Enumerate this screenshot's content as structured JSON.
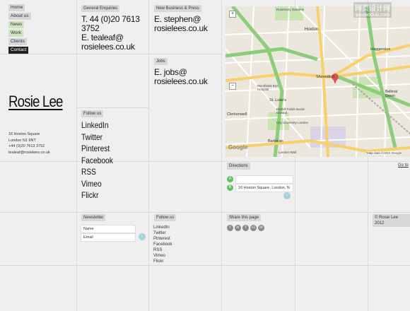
{
  "nav": [
    "Home",
    "About us",
    "News",
    "Work",
    "Clients",
    "Contact"
  ],
  "brand": "Rosie Lee",
  "address": [
    "16 Hoxton Square",
    "London N1 6NT",
    "+44 (0)20 7613 3752",
    "tealeaf@rosielees.co.uk"
  ],
  "general": {
    "label": "General Enquiries",
    "lines": [
      "T. 44 (0)20 7613",
      "3752",
      "E. tealeaf@",
      "rosielees.co.uk"
    ]
  },
  "business": {
    "label": "New Business & Press",
    "lines": [
      "E. stephen@",
      "rosielees.co.uk"
    ]
  },
  "jobs": {
    "label": "Jobs",
    "lines": [
      "E. jobs@",
      "rosielees.co.uk"
    ]
  },
  "follow_big": {
    "label": "Follow us",
    "items": [
      "LinkedIn",
      "Twitter",
      "Pinterest",
      "Facebook",
      "RSS",
      "Vimeo",
      "Flickr"
    ]
  },
  "directions": {
    "label": "Directions",
    "goto": "Go to",
    "from": "A",
    "to": "B",
    "to_value": "16 Hoxton Square, London, N",
    "go_icon": "arrow-right-icon"
  },
  "newsletter": {
    "label": "Newsletter",
    "name_placeholder": "Name",
    "email_placeholder": "Email"
  },
  "follow_small": {
    "label": "Follow us",
    "items": [
      "LinkedIn",
      "Twitter",
      "Pinterest",
      "Facebook",
      "RSS",
      "Vimeo",
      "Flickr"
    ]
  },
  "share": {
    "label": "Share this page",
    "icons": [
      "t",
      "in",
      "f",
      "+1",
      "✉"
    ]
  },
  "copyright": "© Rosie Lee 2012",
  "watermark": {
    "line1": "网页设计网",
    "line2": "ipouwodub.com"
  },
  "map": {
    "attribution": "Map data ©2012 Google",
    "google": "Google",
    "labels": [
      "Rosemary Gardens",
      "Hoxton",
      "Haggerston",
      "Shoreditch",
      "Moorfields Eye Hospital",
      "St. Luke's",
      "Bunhill Fields Burial Ground",
      "City University London",
      "Barbican",
      "Bethnal Green",
      "Clerkenwell",
      "London Wall",
      "Percival St",
      "A1",
      "A501",
      "A10",
      "A1208",
      "A1202",
      "Hackney Rd",
      "A1209",
      "A5201",
      "A201",
      "Pitfield St",
      "Old St"
    ]
  }
}
